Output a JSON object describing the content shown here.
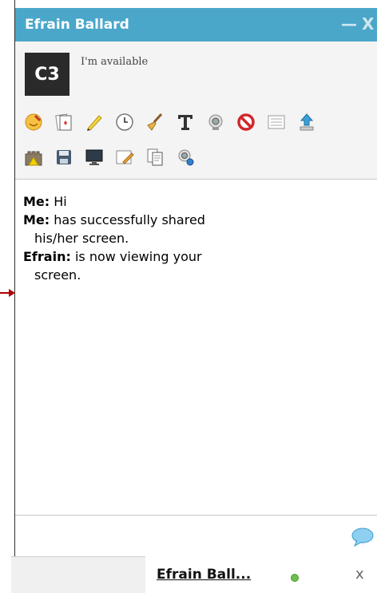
{
  "window": {
    "title": "Efrain Ballard",
    "minimize_symbol": "—",
    "close_symbol": "X"
  },
  "profile": {
    "avatar_text": "C3",
    "status": "I'm available"
  },
  "toolbar_row1": [
    {
      "icon": "emoticon-icon"
    },
    {
      "icon": "card-icon"
    },
    {
      "icon": "pencil-icon"
    },
    {
      "icon": "clock-icon"
    },
    {
      "icon": "broom-icon"
    },
    {
      "icon": "text-format-icon"
    },
    {
      "icon": "webcam-icon"
    },
    {
      "icon": "block-icon"
    },
    {
      "icon": "list-icon"
    },
    {
      "icon": "upload-icon"
    }
  ],
  "toolbar_row2": [
    {
      "icon": "castle-warning-icon"
    },
    {
      "icon": "save-icon"
    },
    {
      "icon": "screen-share-icon"
    },
    {
      "icon": "whiteboard-icon"
    },
    {
      "icon": "documents-icon"
    },
    {
      "icon": "webcam-view-icon"
    }
  ],
  "messages": [
    {
      "sender": "Me:",
      "text": "Hi",
      "cont": ""
    },
    {
      "sender": "Me:",
      "text": "has successfully shared",
      "cont": "his/her screen."
    },
    {
      "sender": "Efrain:",
      "text": "is now viewing your",
      "cont": "screen."
    }
  ],
  "input": {
    "value": "",
    "placeholder": ""
  },
  "taskbar": {
    "name": "Efrain Ball...",
    "close_symbol": "x"
  },
  "colors": {
    "titlebar": "#4aa7c9",
    "online": "#6cc14a",
    "arrow": "#b00000"
  }
}
